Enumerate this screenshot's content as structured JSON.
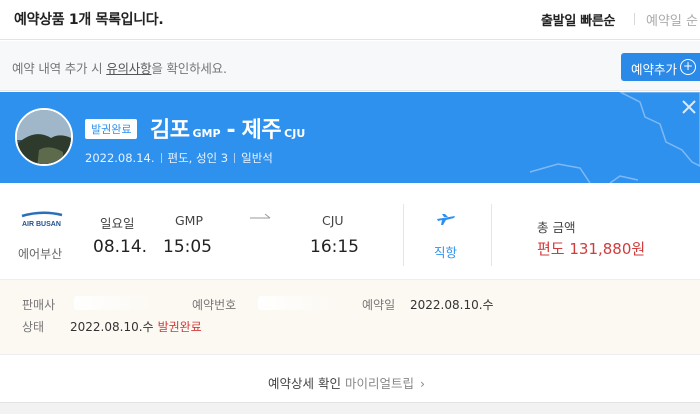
{
  "header": {
    "title": "예약상품 1개 목록입니다.",
    "sort_primary": "출발일 빠른순",
    "sort_secondary": "예약일 순"
  },
  "notice": {
    "text_before": "예약 내역 추가 시 ",
    "link": "유의사항",
    "text_after": "을 확인하세요.",
    "add_button": "예약추가",
    "add_icon": "plus-circle-icon"
  },
  "banner": {
    "status": "발권완료",
    "origin_city": "김포",
    "origin_code": "GMP",
    "dash": "-",
    "dest_city": "제주",
    "dest_code": "CJU",
    "date": "2022.08.14.",
    "trip_type": "편도, 성인 3",
    "seat_class": "일반석",
    "bg_color": "#2f91ee"
  },
  "flight": {
    "airline_logo_text": "AIR BUSAN",
    "airline": "에어부산",
    "day": "일요일",
    "date": "08.14.",
    "dep_code": "GMP",
    "dep_time": "15:05",
    "arr_code": "CJU",
    "arr_time": "16:15",
    "route_type": "직항",
    "total_label": "총 금액",
    "total": "편도 131,880원",
    "price_color": "#d13b3b"
  },
  "details": {
    "seller_label": "판매사",
    "reservation_label": "예약번호",
    "booked_label": "예약일",
    "booked_value": "2022.08.10.수",
    "status_label": "상태",
    "status_date": "2022.08.10.수",
    "status_value": "발권완료"
  },
  "footer": {
    "link_label": "예약상세 확인",
    "link_sub": "마이리얼트립",
    "chevron": "›"
  }
}
